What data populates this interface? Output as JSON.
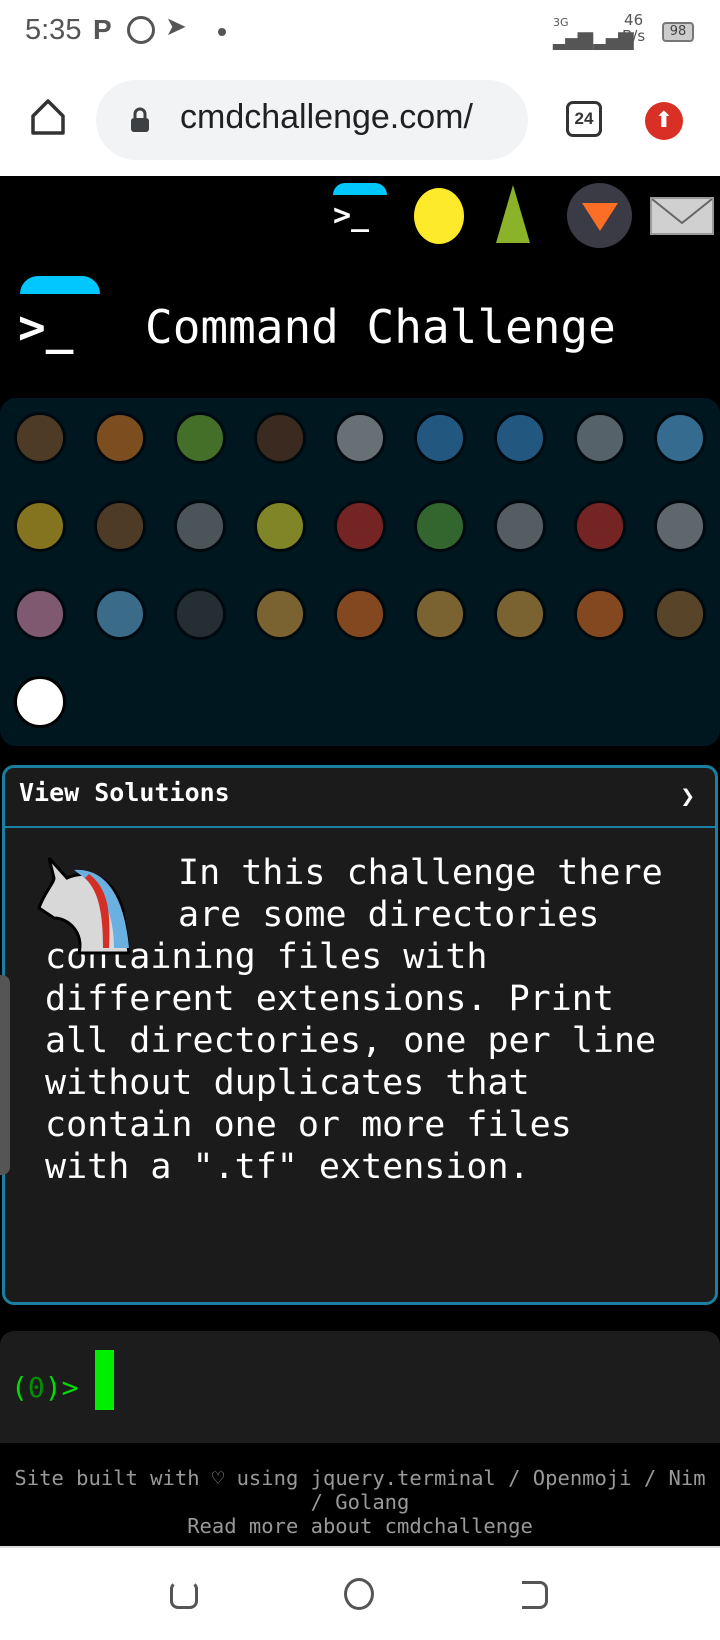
{
  "status_bar": {
    "time": "5:35",
    "network_speed": "46",
    "network_unit": "B/s",
    "battery": "98",
    "network_type": "3G"
  },
  "browser": {
    "url": "cmdchallenge.com/",
    "tab_count": "24"
  },
  "header": {
    "title": "Command Challenge",
    "nav_icons": [
      "terminal-icon",
      "hand-over-mouth-icon",
      "tree-icon",
      "gitlab-icon",
      "mail-icon"
    ]
  },
  "challenges": [
    {
      "icon": "snail",
      "color": "#8b5a2b"
    },
    {
      "icon": "butterfly",
      "color": "#e07a1f"
    },
    {
      "icon": "caterpillar",
      "color": "#7cb82f"
    },
    {
      "icon": "ant",
      "color": "#6b3b1f"
    },
    {
      "icon": "spider-web",
      "color": "#bbbbbb"
    },
    {
      "icon": "whale",
      "color": "#3d8ed0"
    },
    {
      "icon": "whale-2",
      "color": "#3d8ed0"
    },
    {
      "icon": "dolphin",
      "color": "#9aa0a6"
    },
    {
      "icon": "fish",
      "color": "#5fb0e8"
    },
    {
      "icon": "tropical-fish",
      "color": "#f0c020"
    },
    {
      "icon": "blowfish",
      "color": "#8b5a2b"
    },
    {
      "icon": "wolf",
      "color": "#888888"
    },
    {
      "icon": "honeybee",
      "color": "#e8e030"
    },
    {
      "icon": "lady-beetle",
      "color": "#d22f27"
    },
    {
      "icon": "cricket",
      "color": "#5ca83a"
    },
    {
      "icon": "spider",
      "color": "#999999"
    },
    {
      "icon": "scorpion",
      "color": "#d22f27"
    },
    {
      "icon": "fly",
      "color": "#aaaaaa"
    },
    {
      "icon": "worm",
      "color": "#e68fb0"
    },
    {
      "icon": "microbe",
      "color": "#6ab0e0"
    },
    {
      "icon": "gorilla",
      "color": "#444444"
    },
    {
      "icon": "dog",
      "color": "#e0a040"
    },
    {
      "icon": "fox",
      "color": "#f07020"
    },
    {
      "icon": "cat",
      "color": "#e0a040"
    },
    {
      "icon": "lion",
      "color": "#e0a040"
    },
    {
      "icon": "tiger",
      "color": "#f07020"
    },
    {
      "icon": "horse",
      "color": "#a06a30"
    },
    {
      "icon": "unicorn",
      "color": "#ffffff",
      "current": true
    }
  ],
  "solutions": {
    "label": "View Solutions",
    "chevron": "❯"
  },
  "challenge": {
    "description": "In this challenge there are some directories containing files with different extensions. Print all directories, one per line without duplicates that contain one or more files with a \".tf\" extension."
  },
  "terminal": {
    "prompt_open": "(",
    "prompt_code": "0",
    "prompt_close": ")>"
  },
  "footer": {
    "line1": "Site built with ♡ using jquery.terminal / Openmoji / Nim / Golang",
    "line2": "Read more about cmdchallenge"
  }
}
